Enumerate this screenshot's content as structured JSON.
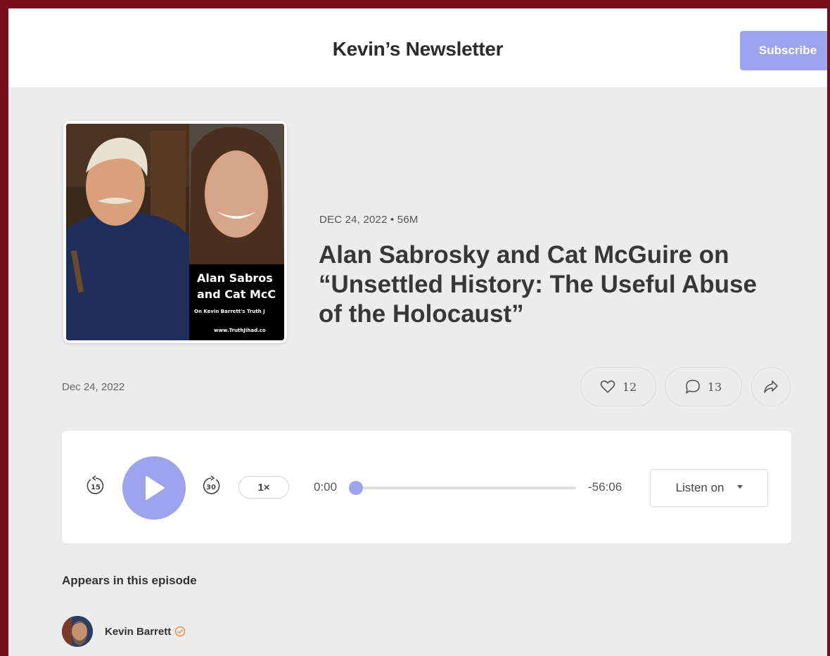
{
  "header": {
    "site_title": "Kevin’s Newsletter",
    "subscribe_label": "Subscribe"
  },
  "cover": {
    "line1": "Alan Sabros",
    "line2": "and Cat McC",
    "line3": "On Kevin Barrett's Truth J",
    "line4": "www.TruthJihad.co"
  },
  "episode": {
    "meta": "DEC 24, 2022 • 56M",
    "title": "Alan Sabrosky and Cat McGuire on “Unsettled History: The Useful Abuse of the Holocaust”",
    "post_date": "Dec 24, 2022"
  },
  "actions": {
    "likes": "12",
    "comments": "13"
  },
  "player": {
    "skip_back_seconds": "15",
    "skip_forward_seconds": "30",
    "speed": "1×",
    "current_time": "0:00",
    "remaining_time": "-56:06",
    "progress_fraction": 0,
    "listen_on_label": "Listen on"
  },
  "appears": {
    "heading": "Appears in this episode",
    "guests": [
      {
        "name": "Kevin Barrett",
        "verified": true
      }
    ]
  },
  "colors": {
    "accent": "#9ea3ee",
    "frame_border": "#7a0f1c",
    "page_background": "#ececec",
    "verified_badge": "#ef8a3b"
  },
  "icons": {
    "like": "heart-icon",
    "comment": "comment-bubble-icon",
    "share": "share-arrow-icon",
    "play": "play-icon",
    "skip_back": "rewind-15-icon",
    "skip_forward": "forward-30-icon",
    "verified": "verified-badge-icon",
    "dropdown": "caret-down-icon"
  }
}
